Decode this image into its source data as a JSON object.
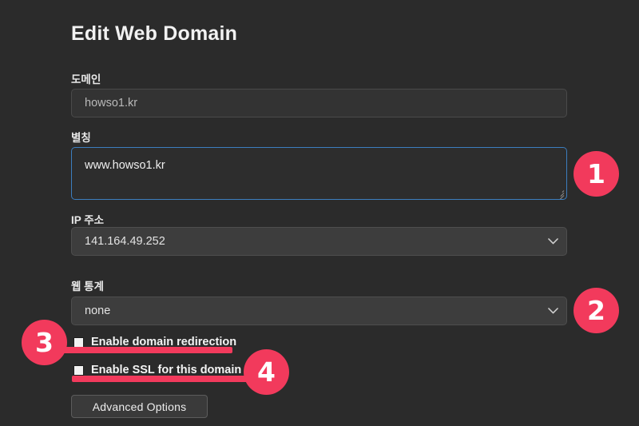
{
  "theme": {
    "background": "#2b2b2b",
    "accent_annotation": "#f23a5c",
    "focus_border": "#3c7ebf",
    "input_background": "#333333",
    "select_background": "#3d3d3d",
    "text_primary": "#f2f2f2"
  },
  "header": {
    "title": "Edit Web Domain"
  },
  "form": {
    "domain": {
      "label": "도메인",
      "value": "howso1.kr",
      "placeholder": "howso1.kr"
    },
    "alias": {
      "label": "별칭",
      "value": "www.howso1.kr",
      "placeholder": ""
    },
    "ip_address": {
      "label": "IP 주소",
      "value": "141.164.49.252",
      "options": [
        "141.164.49.252"
      ]
    },
    "web_statistics": {
      "label": "웹 통계",
      "value": "none",
      "options": [
        "none"
      ]
    },
    "domain_redirection": {
      "label": "Enable domain redirection",
      "checked": false
    },
    "ssl": {
      "label": "Enable SSL for this domain",
      "checked": false
    },
    "advanced_options": {
      "label": "Advanced Options"
    }
  },
  "annotations": {
    "badges": [
      {
        "number": "1"
      },
      {
        "number": "2"
      },
      {
        "number": "3"
      },
      {
        "number": "4"
      }
    ]
  }
}
